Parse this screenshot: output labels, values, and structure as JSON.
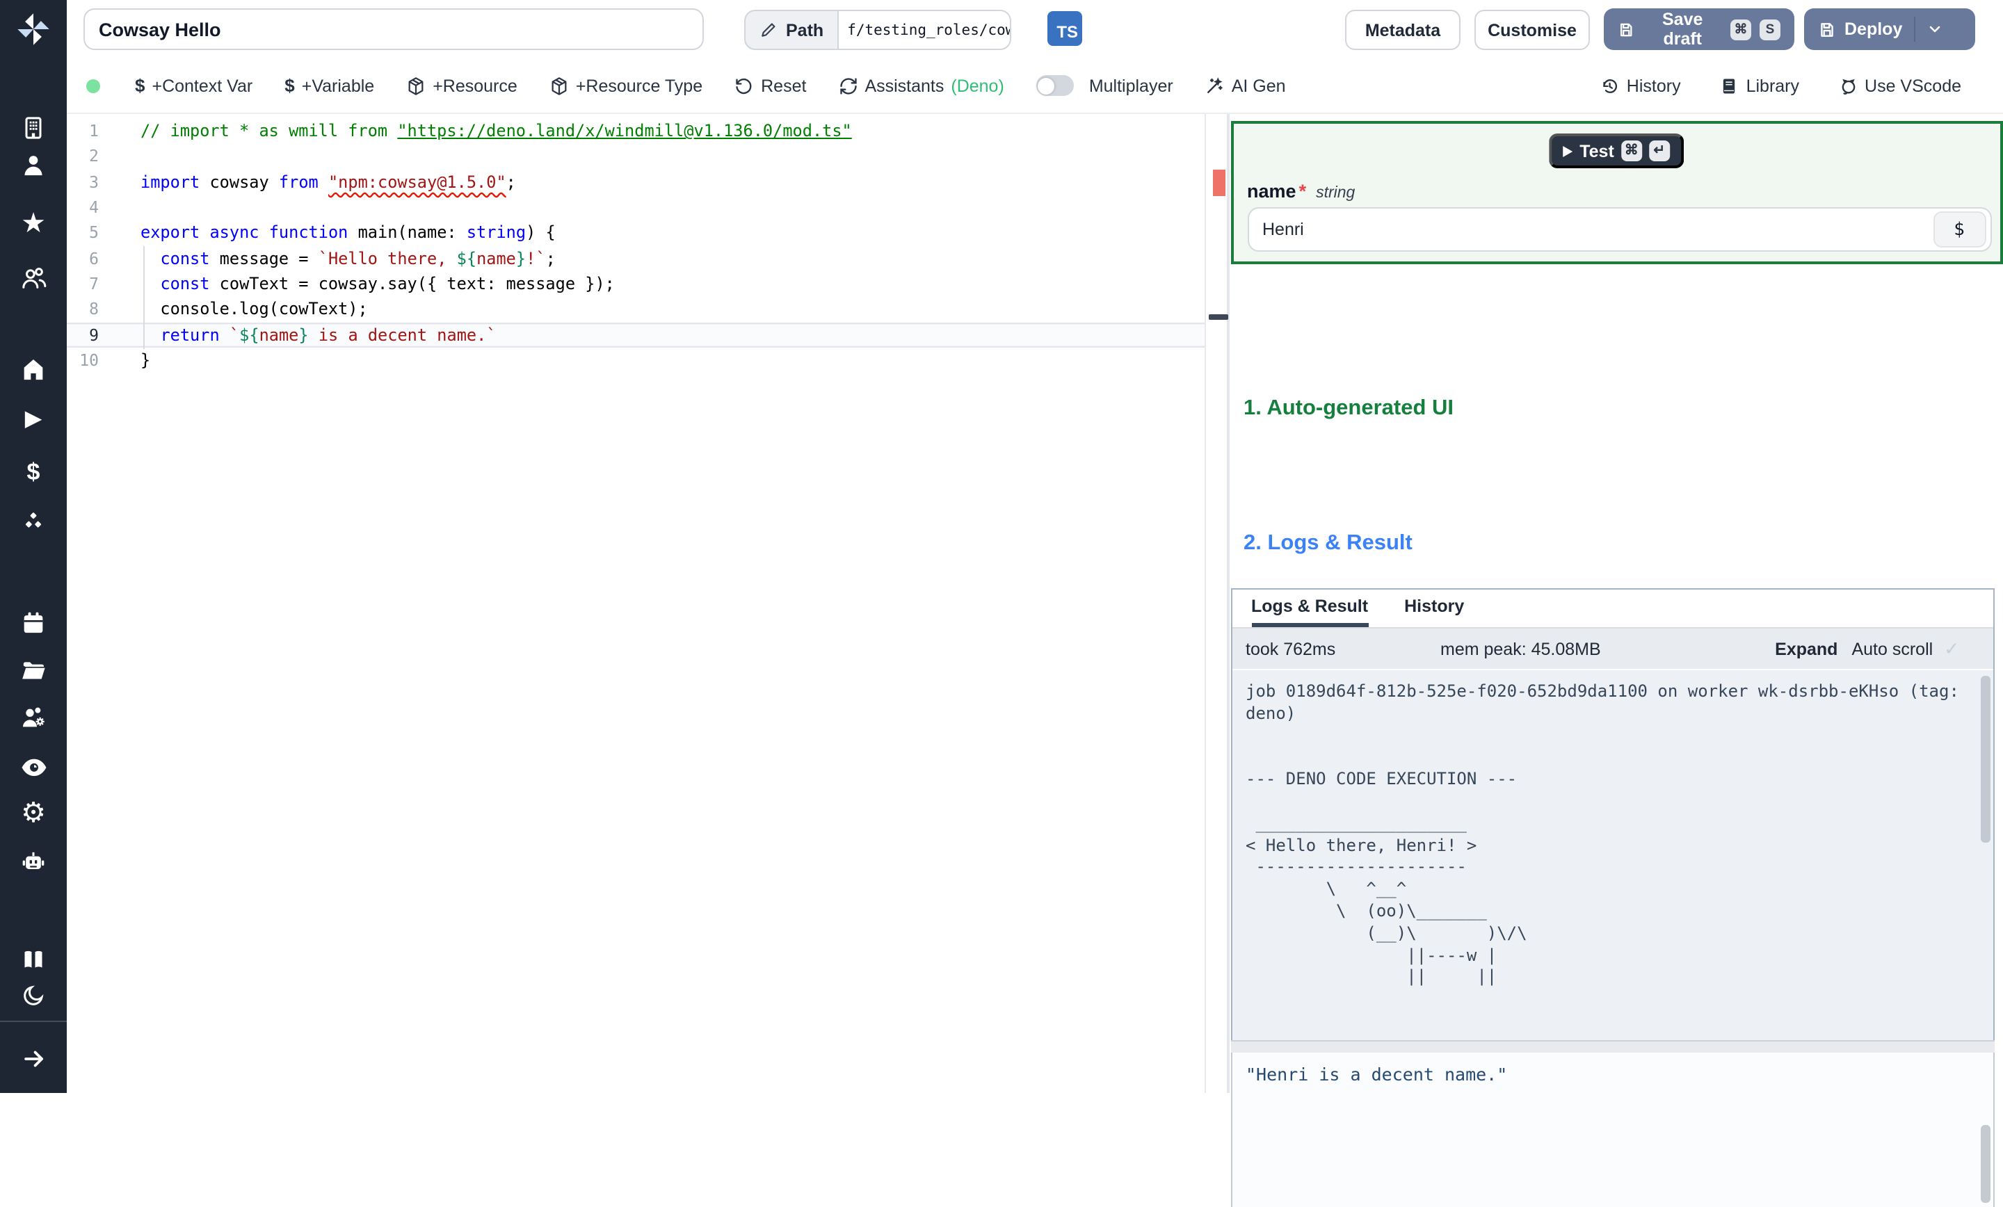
{
  "colors": {
    "sidebar_bg": "#1e2533",
    "slate_button": "#68799c",
    "ts_badge": "#3a72c2",
    "deno_green": "#2fbe74",
    "heading_green": "#15803d",
    "heading_blue": "#3b82f6",
    "error_marker": "#ee7268",
    "status_dot": "#7ce2a0"
  },
  "sidebar": {
    "icons": [
      "windmill-logo",
      "workspace-building",
      "user",
      "favorites-star",
      "groups",
      "home",
      "runs-play",
      "variables-dollar",
      "resources-cubes",
      "schedules-calendar",
      "folders",
      "groups-settings",
      "audit-eye",
      "settings-gear",
      "workers-robot",
      "docs-book",
      "dark-mode-moon",
      "collapse-arrow-right"
    ]
  },
  "topbar": {
    "title": "Cowsay Hello",
    "path_label": "Path",
    "path_value": "f/testing_roles/cowsa",
    "lang_badge": "TS",
    "metadata": "Metadata",
    "customise": "Customise",
    "save_draft": "Save draft",
    "save_kbd_cmd": "⌘",
    "save_kbd_s": "S",
    "deploy": "Deploy"
  },
  "toolbar": {
    "context_var": "+Context Var",
    "variable": "+Variable",
    "resource": "+Resource",
    "resource_type": "+Resource Type",
    "reset": "Reset",
    "assistants": "Assistants",
    "assistants_suffix": "(Deno)",
    "multiplayer": "Multiplayer",
    "ai_gen": "AI Gen",
    "history": "History",
    "library": "Library",
    "use_vscode": "Use VScode",
    "dollar": "$"
  },
  "editor": {
    "active_line": 9,
    "lines": [
      {
        "n": 1,
        "segments": [
          {
            "t": "// import * as wmill from ",
            "c": "comment"
          },
          {
            "t": "\"https://deno.land/x/windmill@v1.136.0/mod.ts\"",
            "c": "comment link"
          }
        ]
      },
      {
        "n": 2,
        "segments": []
      },
      {
        "n": 3,
        "segments": [
          {
            "t": "import",
            "c": "kw"
          },
          {
            "t": " cowsay ",
            "c": "plain"
          },
          {
            "t": "from",
            "c": "kw"
          },
          {
            "t": " ",
            "c": "plain"
          },
          {
            "t": "\"npm:cowsay@1.5.0\"",
            "c": "str squiggle"
          },
          {
            "t": ";",
            "c": "plain"
          }
        ]
      },
      {
        "n": 4,
        "segments": []
      },
      {
        "n": 5,
        "segments": [
          {
            "t": "export",
            "c": "kw"
          },
          {
            "t": " ",
            "c": "plain"
          },
          {
            "t": "async",
            "c": "kw"
          },
          {
            "t": " ",
            "c": "plain"
          },
          {
            "t": "function",
            "c": "kw"
          },
          {
            "t": " main(name: ",
            "c": "plain"
          },
          {
            "t": "string",
            "c": "kw"
          },
          {
            "t": ") {",
            "c": "plain"
          }
        ]
      },
      {
        "n": 6,
        "segments": [
          {
            "t": "  ",
            "c": "plain"
          },
          {
            "t": "const",
            "c": "kw"
          },
          {
            "t": " message = ",
            "c": "plain"
          },
          {
            "t": "`Hello there, ",
            "c": "str"
          },
          {
            "t": "${",
            "c": "interp"
          },
          {
            "t": "name",
            "c": "str"
          },
          {
            "t": "}",
            "c": "interp"
          },
          {
            "t": "!`",
            "c": "str"
          },
          {
            "t": ";",
            "c": "plain"
          }
        ]
      },
      {
        "n": 7,
        "segments": [
          {
            "t": "  ",
            "c": "plain"
          },
          {
            "t": "const",
            "c": "kw"
          },
          {
            "t": " cowText = cowsay.say({ text: message });",
            "c": "plain"
          }
        ]
      },
      {
        "n": 8,
        "segments": [
          {
            "t": "  console.log(cowText);",
            "c": "plain"
          }
        ]
      },
      {
        "n": 9,
        "segments": [
          {
            "t": "  ",
            "c": "plain"
          },
          {
            "t": "return",
            "c": "kw"
          },
          {
            "t": " ",
            "c": "plain"
          },
          {
            "t": "`",
            "c": "str"
          },
          {
            "t": "${",
            "c": "interp"
          },
          {
            "t": "name",
            "c": "str"
          },
          {
            "t": "}",
            "c": "interp"
          },
          {
            "t": " is a decent name.`",
            "c": "str"
          }
        ]
      },
      {
        "n": 10,
        "segments": [
          {
            "t": "}",
            "c": "plain"
          }
        ]
      }
    ]
  },
  "panel": {
    "test": "Test",
    "test_kbd_cmd": "⌘",
    "test_kbd_enter": "↵",
    "field": {
      "name": "name",
      "required": "*",
      "type": "string",
      "value": "Henri",
      "suffix": "$"
    },
    "h1": "1. Auto-generated UI",
    "h2": "2. Logs & Result",
    "tabs": [
      "Logs & Result",
      "History"
    ],
    "took": "took 762ms",
    "mem": "mem peak: 45.08MB",
    "expand": "Expand",
    "autoscroll": "Auto scroll",
    "check": "✓",
    "logs": "job 0189d64f-812b-525e-f020-652bd9da1100 on worker wk-dsrbb-eKHso (tag:\ndeno)\n\n\n--- DENO CODE EXECUTION ---\n\n _____________________\n< Hello there, Henri! >\n ---------------------\n        \\   ^__^\n         \\  (oo)\\_______\n            (__)\\       )\\/\\\n                ||----w |\n                ||     ||",
    "result": "\"Henri is a decent name.\""
  }
}
